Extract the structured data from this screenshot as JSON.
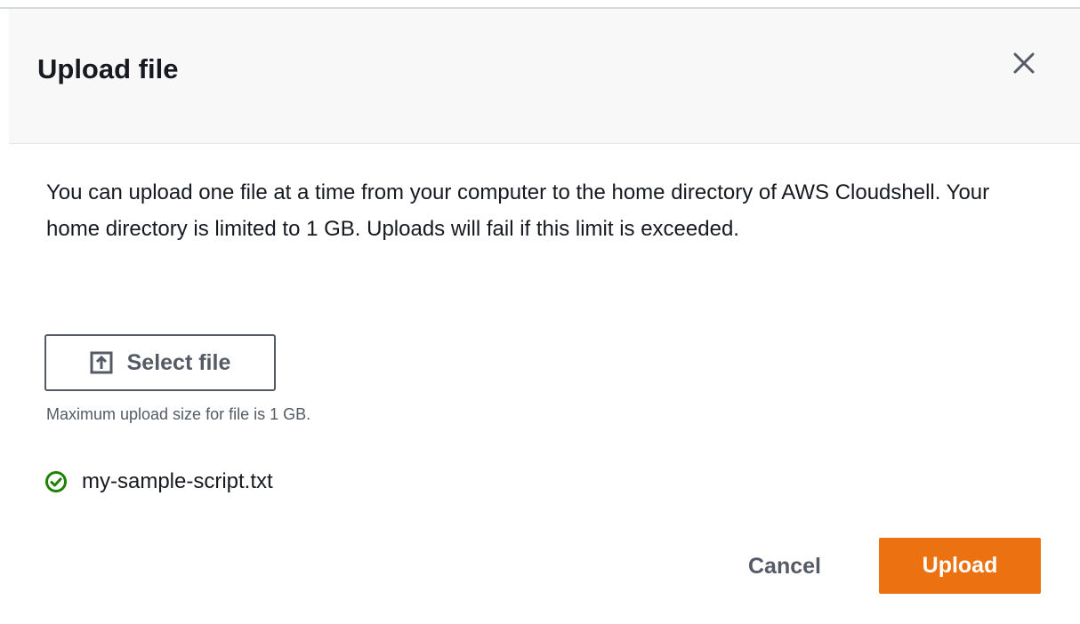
{
  "modal": {
    "title": "Upload file",
    "description": "You can upload one file at a time from your computer to the home directory of AWS Cloudshell. Your home directory is limited to 1 GB. Uploads will fail if this limit is exceeded.",
    "select_file_label": "Select file",
    "hint": "Maximum upload size for file is 1 GB.",
    "uploaded_file": {
      "name": "my-sample-script.txt",
      "status": "success",
      "status_icon": "check-circle-icon"
    },
    "cancel_label": "Cancel",
    "upload_label": "Upload"
  },
  "colors": {
    "header_background": "#f8f8f8",
    "primary_button": "#ec7211",
    "success": "#1d8102",
    "text": "#16191f",
    "secondary_text": "#545b64"
  },
  "icons": {
    "close": "close-icon",
    "select_file": "upload-icon",
    "file_status": "check-circle-icon"
  }
}
